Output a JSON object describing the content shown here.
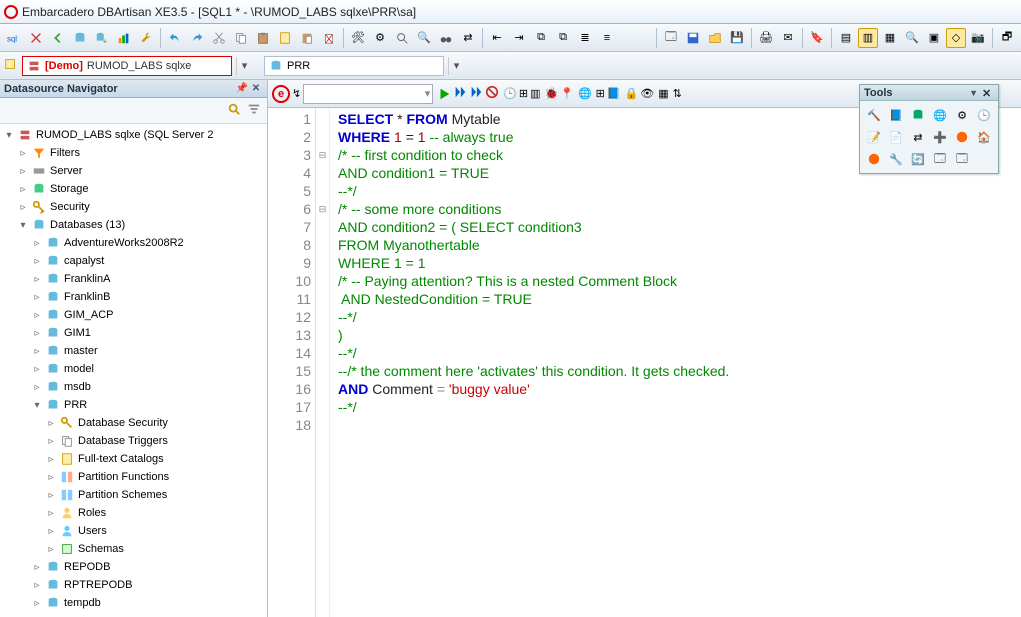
{
  "window": {
    "title": "Embarcadero DBArtisan XE3.5 - [SQL1 * - \\RUMOD_LABS sqlxe\\PRR\\sa]"
  },
  "datasource_bar": {
    "demo_label": "[Demo]",
    "ds_name": "RUMOD_LABS sqlxe",
    "db_name": "PRR"
  },
  "navigator": {
    "title": "Datasource Navigator",
    "root": "RUMOD_LABS sqlxe (SQL Server 2",
    "nodes": {
      "filters": "Filters",
      "server": "Server",
      "storage": "Storage",
      "security": "Security",
      "databases": "Databases (13)",
      "db_list": [
        "AdventureWorks2008R2",
        "capalyst",
        "FranklinA",
        "FranklinB",
        "GIM_ACP",
        "GIM1",
        "master",
        "model",
        "msdb",
        "PRR",
        "REPODB",
        "RPTREPODB",
        "tempdb"
      ],
      "prr_children": [
        "Database Security",
        "Database Triggers",
        "Full-text Catalogs",
        "Partition Functions",
        "Partition Schemes",
        "Roles",
        "Users",
        "Schemas"
      ]
    }
  },
  "editor": {
    "lines": [
      {
        "n": 1,
        "fold": "",
        "tokens": [
          [
            "kw",
            "SELECT"
          ],
          [
            "ident",
            " * "
          ],
          [
            "kw",
            "FROM"
          ],
          [
            "ident",
            " Mytable"
          ]
        ]
      },
      {
        "n": 2,
        "fold": "",
        "tokens": [
          [
            "kw",
            "WHERE"
          ],
          [
            "ident",
            " "
          ],
          [
            "num",
            "1"
          ],
          [
            "ident",
            " = "
          ],
          [
            "num",
            "1"
          ],
          [
            "ident",
            " "
          ],
          [
            "cmt",
            "-- always true"
          ]
        ]
      },
      {
        "n": 3,
        "fold": "-",
        "tokens": [
          [
            "cmt",
            "/* -- first condition to check"
          ]
        ]
      },
      {
        "n": 4,
        "fold": "",
        "tokens": [
          [
            "cmt",
            "AND condition1 = TRUE"
          ]
        ]
      },
      {
        "n": 5,
        "fold": "",
        "tokens": [
          [
            "cmt",
            "--*/"
          ]
        ]
      },
      {
        "n": 6,
        "fold": "-",
        "tokens": [
          [
            "cmt",
            "/* -- some more conditions"
          ]
        ]
      },
      {
        "n": 7,
        "fold": "",
        "tokens": [
          [
            "cmt",
            "AND condition2 = ( SELECT condition3"
          ]
        ]
      },
      {
        "n": 8,
        "fold": "",
        "tokens": [
          [
            "cmt",
            "FROM Myanothertable"
          ]
        ]
      },
      {
        "n": 9,
        "fold": "",
        "tokens": [
          [
            "cmt",
            "WHERE 1 = 1"
          ]
        ]
      },
      {
        "n": 10,
        "fold": "",
        "tokens": [
          [
            "cmt",
            "/* -- Paying attention? This is a nested Comment Block"
          ]
        ]
      },
      {
        "n": 11,
        "fold": "",
        "tokens": [
          [
            "cmt",
            " AND NestedCondition = TRUE"
          ]
        ]
      },
      {
        "n": 12,
        "fold": "",
        "tokens": [
          [
            "cmt",
            "--*/"
          ]
        ]
      },
      {
        "n": 13,
        "fold": "",
        "tokens": [
          [
            "cmt",
            ")"
          ]
        ]
      },
      {
        "n": 14,
        "fold": "",
        "tokens": [
          [
            "cmt",
            "--*/"
          ]
        ]
      },
      {
        "n": 15,
        "fold": "",
        "tokens": [
          [
            "cmt",
            "--/* the comment here 'activates' this condition. It gets checked."
          ]
        ]
      },
      {
        "n": 16,
        "fold": "",
        "tokens": [
          [
            "kw",
            "AND"
          ],
          [
            "ident",
            " Comment "
          ],
          [
            "op",
            "="
          ],
          [
            "ident",
            " "
          ],
          [
            "str",
            "'buggy value'"
          ]
        ]
      },
      {
        "n": 17,
        "fold": "",
        "tokens": [
          [
            "cmt",
            "--*/"
          ]
        ]
      },
      {
        "n": 18,
        "fold": "",
        "tokens": []
      }
    ]
  },
  "tools_panel": {
    "title": "Tools"
  }
}
